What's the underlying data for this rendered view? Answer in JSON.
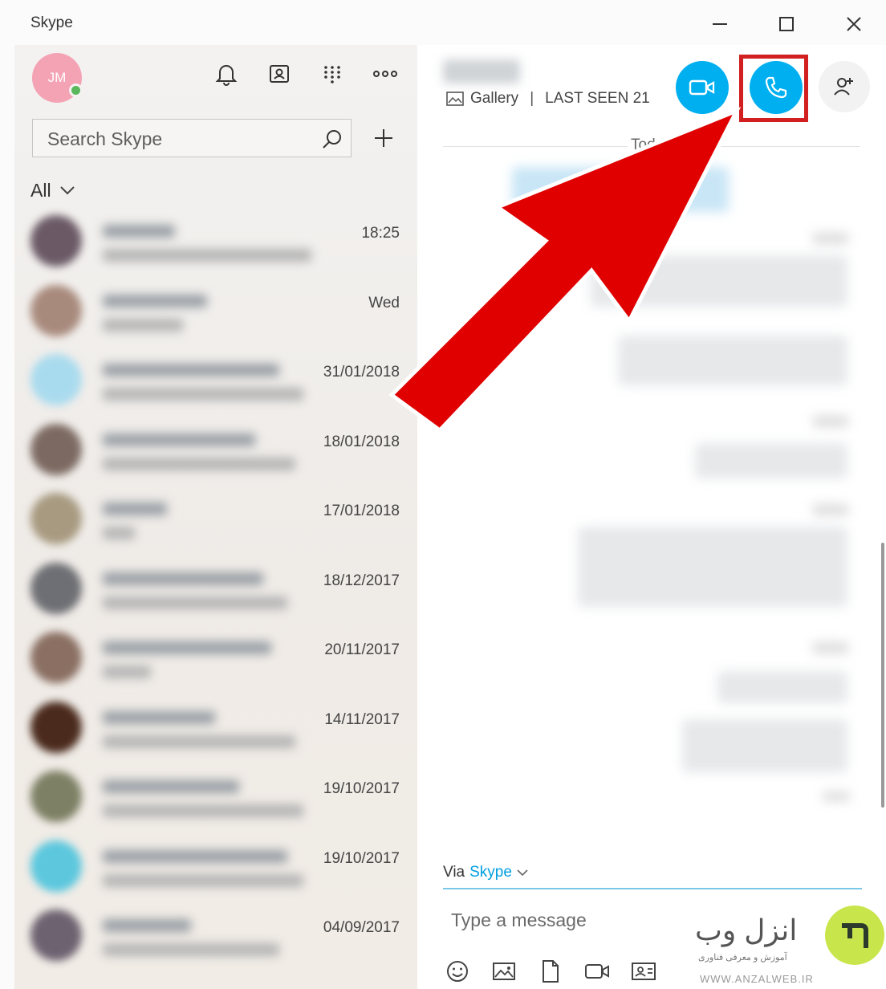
{
  "window": {
    "title": "Skype"
  },
  "sidebar": {
    "user_initials": "JM",
    "search_placeholder": "Search Skype",
    "filter_label": "All",
    "chats": [
      {
        "time": "18:25"
      },
      {
        "time": "Wed"
      },
      {
        "time": "31/01/2018"
      },
      {
        "time": "18/01/2018"
      },
      {
        "time": "17/01/2018"
      },
      {
        "time": "18/12/2017"
      },
      {
        "time": "20/11/2017"
      },
      {
        "time": "14/11/2017"
      },
      {
        "time": "19/10/2017"
      },
      {
        "time": "19/10/2017"
      },
      {
        "time": "04/09/2017"
      }
    ]
  },
  "conversation": {
    "gallery_label": "Gallery",
    "separator": "|",
    "last_seen": "LAST SEEN 21",
    "day_label": "Today",
    "via_label": "Via",
    "via_service": "Skype",
    "message_placeholder": "Type a message"
  },
  "watermark": {
    "brand": "انزل وب",
    "tagline": "آموزش و معرفی فناوری",
    "url": "WWW.ANZALWEB.IR"
  },
  "colors": {
    "accent": "#00aff0",
    "highlight": "#d21f1f",
    "arrow": "#e00000",
    "presence": "#5bb75b"
  }
}
